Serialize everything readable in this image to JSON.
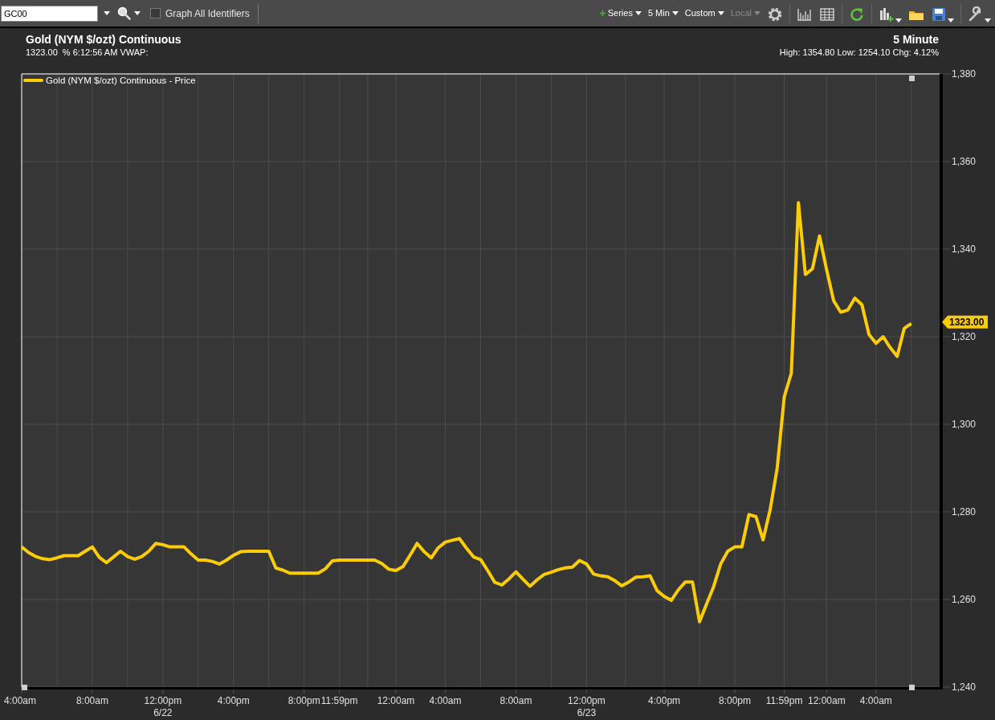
{
  "toolbar": {
    "symbol": "GC00",
    "checkbox": {
      "label": "Graph All Identifiers",
      "checked": false
    },
    "menus": [
      {
        "label": "Series",
        "kind": "add",
        "disabled": false
      },
      {
        "label": "5 Min",
        "kind": "plain",
        "disabled": false
      },
      {
        "label": "Custom",
        "kind": "plain",
        "disabled": false
      },
      {
        "label": "Local",
        "kind": "plain",
        "disabled": true
      }
    ]
  },
  "header": {
    "title": "Gold (NYM $/ozt) Continuous",
    "quote": "1323.00  % 6:12:56 AM VWAP:",
    "interval": "5 Minute",
    "stats": "High: 1354.80 Low: 1254.10 Chg: 4.12%"
  },
  "chart": {
    "last_price_tag": "1323.00",
    "date_labels": [
      "6/22",
      "6/23"
    ],
    "chart_data": {
      "type": "line",
      "grid": true,
      "ylim": [
        1240,
        1380
      ],
      "yticks": [
        {
          "value": 1240,
          "label": "1,240"
        },
        {
          "value": 1260,
          "label": "1,260"
        },
        {
          "value": 1280,
          "label": "1,280"
        },
        {
          "value": 1300,
          "label": "1,300"
        },
        {
          "value": 1320,
          "label": "1,320"
        },
        {
          "value": 1340,
          "label": "1,340"
        },
        {
          "value": 1360,
          "label": "1,360"
        },
        {
          "value": 1380,
          "label": "1,380"
        }
      ],
      "categories": [
        "4:00am",
        null,
        null,
        null,
        null,
        null,
        null,
        null,
        null,
        null,
        "8:00am",
        null,
        null,
        null,
        null,
        null,
        null,
        null,
        null,
        null,
        "12:00pm",
        null,
        null,
        null,
        null,
        null,
        null,
        null,
        null,
        null,
        "4:00pm",
        null,
        null,
        null,
        null,
        null,
        null,
        null,
        null,
        null,
        "8:00pm",
        null,
        null,
        null,
        null,
        "11:59pm",
        null,
        null,
        null,
        null,
        null,
        null,
        null,
        "12:00am",
        null,
        null,
        null,
        null,
        null,
        null,
        "4:00am",
        null,
        null,
        null,
        null,
        null,
        null,
        null,
        null,
        null,
        "8:00am",
        null,
        null,
        null,
        null,
        null,
        null,
        null,
        null,
        null,
        "12:00pm",
        null,
        null,
        null,
        null,
        null,
        null,
        null,
        null,
        null,
        null,
        "4:00pm",
        null,
        null,
        null,
        null,
        null,
        null,
        null,
        null,
        null,
        "8:00pm",
        null,
        null,
        null,
        null,
        null,
        null,
        "11:59pm",
        null,
        null,
        null,
        null,
        null,
        "12:00am",
        null,
        null,
        null,
        null,
        null,
        null,
        "4:00am",
        null,
        null,
        null,
        null,
        null
      ],
      "series": [
        {
          "name": "Gold (NYM $/ozt) Continuous - Price",
          "color": "#ffcc00",
          "values": [
            1272,
            1270.7,
            1269.8,
            1269.3,
            1269.1,
            1269.5,
            1270,
            1270,
            1270,
            1271,
            1272,
            1269.6,
            1268.4,
            1269.7,
            1271,
            1269.8,
            1269.2,
            1269.8,
            1271,
            1272.8,
            1272.5,
            1272,
            1272,
            1272,
            1270.4,
            1269,
            1269,
            1268.7,
            1268.1,
            1269,
            1270.1,
            1270.9,
            1271,
            1271,
            1271,
            1271,
            1267.2,
            1266.7,
            1266,
            1266,
            1266,
            1266,
            1266,
            1267,
            1268.8,
            1269,
            1269,
            1269,
            1269,
            1269,
            1269,
            1268.2,
            1266.9,
            1266.6,
            1267.5,
            1270.1,
            1272.8,
            1270.9,
            1269.5,
            1271.8,
            1273.1,
            1273.5,
            1273.9,
            1271.7,
            1269.7,
            1269.1,
            1266.6,
            1263.9,
            1263.3,
            1264.7,
            1266.3,
            1264.6,
            1263,
            1264.5,
            1265.7,
            1266.2,
            1266.8,
            1267.2,
            1267.4,
            1268.9,
            1268.1,
            1265.8,
            1265.4,
            1265.2,
            1264.3,
            1263.1,
            1264,
            1265.1,
            1265.2,
            1265.4,
            1262,
            1260.7,
            1259.8,
            1262.2,
            1264,
            1264,
            1254.9,
            1259,
            1262.9,
            1268.1,
            1271,
            1272,
            1272,
            1279.4,
            1278.9,
            1273.6,
            1280.5,
            1290,
            1306.3,
            1311.7,
            1350.6,
            1334.2,
            1335.5,
            1343,
            1335.3,
            1328.2,
            1325.6,
            1326.1,
            1328.8,
            1327.3,
            1320.5,
            1318.5,
            1320,
            1317.5,
            1315.5,
            1321.9,
            1323
          ]
        }
      ]
    }
  }
}
